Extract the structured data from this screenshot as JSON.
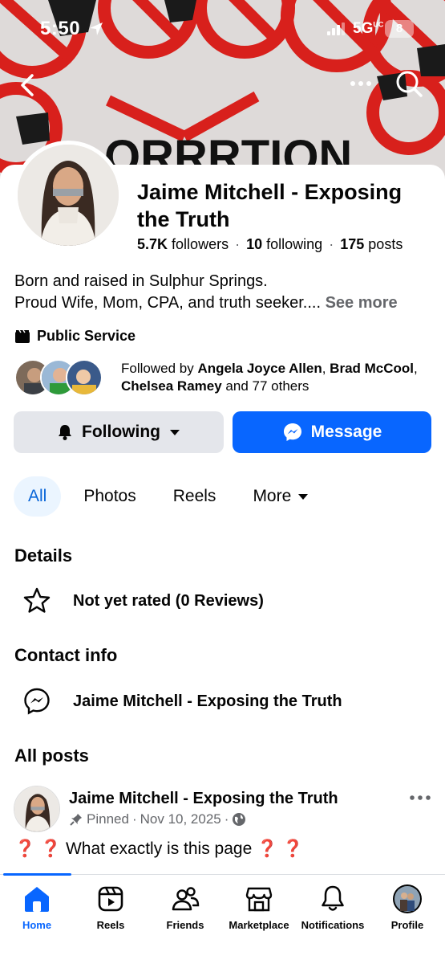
{
  "status_bar": {
    "time": "5:50",
    "network": "5G",
    "network_sup": "UC",
    "battery": "8"
  },
  "profile": {
    "name": "Jaime Mitchell - Exposing the Truth",
    "followers_count": "5.7K",
    "followers_label": "followers",
    "following_count": "10",
    "following_label": "following",
    "posts_count": "175",
    "posts_label": "posts",
    "bio_line1": "Born and raised in Sulphur Springs.",
    "bio_line2": "Proud Wife, Mom, CPA, and truth seeker....",
    "see_more": "See more",
    "category": "Public Service",
    "followed_by_prefix": "Followed by",
    "followed_by_names": [
      "Angela Joyce Allen",
      "Brad McCool",
      "Chelsea Ramey"
    ],
    "followed_by_suffix": "and 77 others"
  },
  "actions": {
    "following_label": "Following",
    "message_label": "Message"
  },
  "tabs": [
    {
      "label": "All",
      "active": true
    },
    {
      "label": "Photos"
    },
    {
      "label": "Reels"
    },
    {
      "label": "More"
    }
  ],
  "details": {
    "heading": "Details",
    "rating": "Not yet rated (0 Reviews)"
  },
  "contact": {
    "heading": "Contact info",
    "messenger": "Jaime Mitchell - Exposing the Truth"
  },
  "posts": {
    "heading": "All posts",
    "first": {
      "author": "Jaime Mitchell - Exposing the Truth",
      "pinned": "Pinned",
      "date": "Nov 10, 2025",
      "text": "What exactly is this page"
    }
  },
  "nav": [
    {
      "label": "Home",
      "icon": "home-icon",
      "active": true
    },
    {
      "label": "Reels",
      "icon": "reels-icon"
    },
    {
      "label": "Friends",
      "icon": "friends-icon"
    },
    {
      "label": "Marketplace",
      "icon": "marketplace-icon"
    },
    {
      "label": "Notifications",
      "icon": "bell-icon"
    },
    {
      "label": "Profile",
      "icon": "profile-avatar-icon"
    }
  ],
  "colors": {
    "accent": "#0866ff",
    "tab_active_bg": "#ebf5ff",
    "secondary_text": "#65676b",
    "button_gray": "#e4e6eb"
  }
}
